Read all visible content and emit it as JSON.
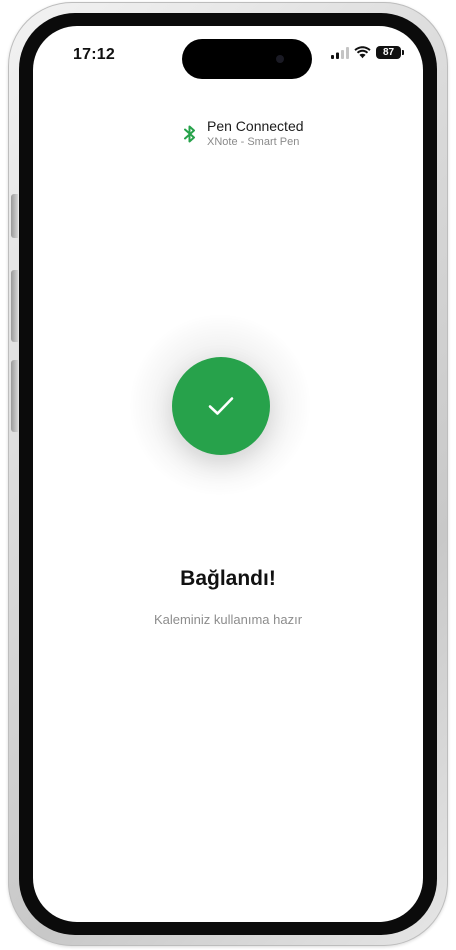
{
  "status_bar": {
    "time": "17:12",
    "battery": "87",
    "icons": [
      "signal-icon",
      "wifi-icon",
      "battery-icon"
    ]
  },
  "connection": {
    "icon": "bluetooth-icon",
    "title": "Pen Connected",
    "subtitle": "XNote - Smart Pen",
    "accent_color": "#27a24b"
  },
  "success": {
    "icon": "checkmark-icon",
    "circle_color": "#27a24b",
    "title": "Bağlandı!",
    "subtitle": "Kaleminiz kullanıma hazır"
  }
}
